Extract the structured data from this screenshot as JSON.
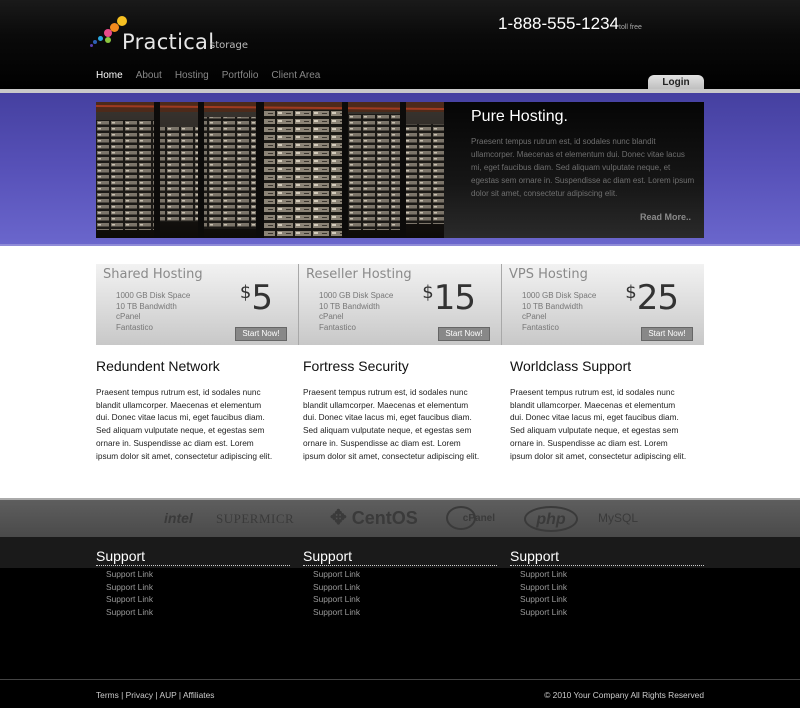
{
  "header": {
    "logo_main": "Practical",
    "logo_sub": "storage",
    "phone": "1-888-555-1234",
    "phone_note": "toll free",
    "nav": [
      "Home",
      "About",
      "Hosting",
      "Portfolio",
      "Client Area"
    ],
    "login": "Login"
  },
  "hero": {
    "title": "Pure Hosting.",
    "text": "Praesent tempus rutrum est, id sodales nunc blandit ullamcorper. Maecenas et elementum dui. Donec vitae lacus mi, eget faucibus diam. Sed aliquam vulputate neque, et egestas sem ornare in. Suspendisse ac diam est. Lorem ipsum dolor sit amet, consectetur adipiscing elit.",
    "read_more": "Read More.."
  },
  "plans": [
    {
      "name": "Shared Hosting",
      "features": [
        "1000 GB Disk Space",
        "10 TB Bandwidth",
        "cPanel",
        "Fantastico"
      ],
      "currency": "$",
      "price": "5",
      "button": "Start Now!"
    },
    {
      "name": "Reseller Hosting",
      "features": [
        "1000 GB Disk Space",
        "10 TB Bandwidth",
        "cPanel",
        "Fantastico"
      ],
      "currency": "$",
      "price": "15",
      "button": "Start Now!"
    },
    {
      "name": "VPS Hosting",
      "features": [
        "1000 GB Disk Space",
        "10 TB Bandwidth",
        "cPanel",
        "Fantastico"
      ],
      "currency": "$",
      "price": "25",
      "button": "Start Now!"
    }
  ],
  "features": [
    {
      "title": "Redundent Network",
      "text": "Praesent tempus rutrum est, id sodales nunc blandit ullamcorper. Maecenas et elementum dui. Donec vitae lacus mi, eget faucibus diam. Sed aliquam vulputate neque, et egestas sem ornare in. Suspendisse ac diam est. Lorem ipsum dolor sit amet, consectetur adipiscing elit."
    },
    {
      "title": "Fortress Security",
      "text": "Praesent tempus rutrum est, id sodales nunc blandit ullamcorper. Maecenas et elementum dui. Donec vitae lacus mi, eget faucibus diam. Sed aliquam vulputate neque, et egestas sem ornare in. Suspendisse ac diam est. Lorem ipsum dolor sit amet, consectetur adipiscing elit."
    },
    {
      "title": "Worldclass Support",
      "text": "Praesent tempus rutrum est, id sodales nunc blandit ullamcorper. Maecenas et elementum dui. Donec vitae lacus mi, eget faucibus diam. Sed aliquam vulputate neque, et egestas sem ornare in. Suspendisse ac diam est. Lorem ipsum dolor sit amet, consectetur adipiscing elit."
    }
  ],
  "tech_logos": [
    "intel",
    "SUPERMICR",
    "CentOS",
    "cPanel",
    "php",
    "MySQL"
  ],
  "footer": {
    "columns": [
      {
        "title": "Support",
        "links": [
          "Support Link",
          "Support Link",
          "Support Link",
          "Support Link"
        ]
      },
      {
        "title": "Support",
        "links": [
          "Support Link",
          "Support Link",
          "Support Link",
          "Support Link"
        ]
      },
      {
        "title": "Support",
        "links": [
          "Support Link",
          "Support Link",
          "Support Link",
          "Support Link"
        ]
      }
    ],
    "bottom_links": [
      "Terms",
      "Privacy",
      "AUP",
      "Affiliates"
    ],
    "separator": "|",
    "copyright": "© 2010 Your Company All Rights Reserved"
  }
}
